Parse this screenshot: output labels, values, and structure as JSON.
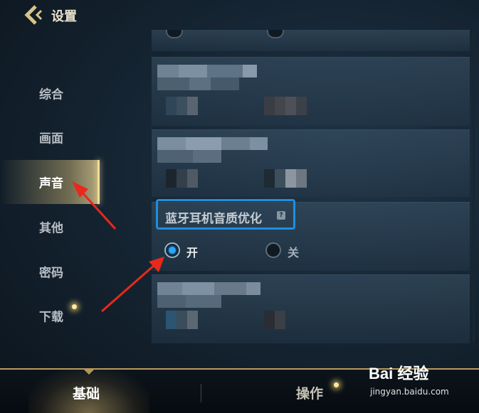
{
  "header": {
    "title": "设置",
    "back_icon": "chevron-left-icon"
  },
  "sidebar": {
    "items": [
      {
        "label": "综合",
        "active": false
      },
      {
        "label": "画面",
        "active": false
      },
      {
        "label": "声音",
        "active": true
      },
      {
        "label": "其他",
        "active": false
      },
      {
        "label": "密码",
        "active": false
      },
      {
        "label": "下载",
        "active": false,
        "has_notification_dot": true
      }
    ]
  },
  "main": {
    "bluetooth_setting": {
      "title": "蓝牙耳机音质优化",
      "help_icon": "?",
      "options": [
        {
          "label": "开",
          "selected": true
        },
        {
          "label": "关",
          "selected": false
        }
      ]
    }
  },
  "tabbar": {
    "tabs": [
      {
        "label": "基础",
        "active": true
      },
      {
        "label": "操作",
        "active": false,
        "has_notification_dot": true
      }
    ]
  },
  "watermark": {
    "brand": "Bai 经验",
    "url": "jingyan.baidu.com"
  },
  "colors": {
    "accent_gold": "#f3dc97",
    "highlight_blue": "#1e8fe0",
    "annotation_red": "#e8291c"
  }
}
